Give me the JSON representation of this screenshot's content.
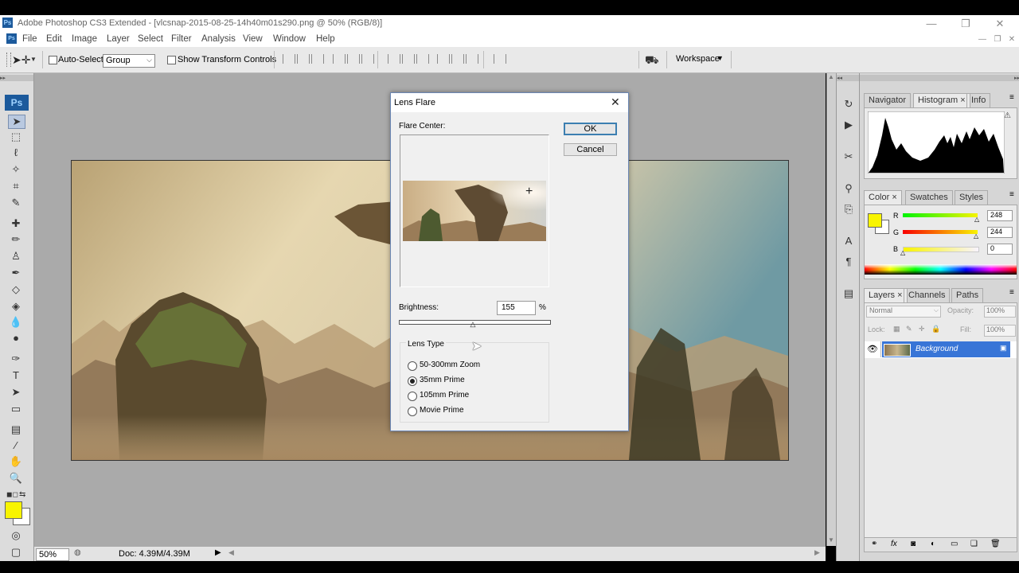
{
  "window": {
    "title": "Adobe Photoshop CS3 Extended - [vlcsnap-2015-08-25-14h40m01s290.png @ 50% (RGB/8)]",
    "app_icon": "Ps",
    "minimize": "—",
    "maximize": "❐",
    "close": "✕"
  },
  "menu": [
    "File",
    "Edit",
    "Image",
    "Layer",
    "Select",
    "Filter",
    "Analysis",
    "View",
    "Window",
    "Help"
  ],
  "options_bar": {
    "auto_select_label": "Auto-Select:",
    "auto_select_value": "Group",
    "show_transform_label": "Show Transform Controls",
    "workspace_label": "Workspace"
  },
  "toolbox": {
    "logo": "Ps",
    "foreground_color": "#f8f400",
    "background_color": "#ffffff"
  },
  "status": {
    "zoom": "50%",
    "doc": "Doc: 4.39M/4.39M"
  },
  "dialog": {
    "title": "Lens Flare",
    "flare_center_label": "Flare Center:",
    "ok": "OK",
    "cancel": "Cancel",
    "brightness_label": "Brightness:",
    "brightness_value": "155",
    "brightness_unit": "%",
    "brightness_fraction": 0.5,
    "lens_type_label": "Lens Type",
    "lens_types": [
      "50-300mm Zoom",
      "35mm Prime",
      "105mm Prime",
      "Movie Prime"
    ],
    "selected_lens": "35mm Prime"
  },
  "panels": {
    "nav_tabs": [
      "Navigator",
      "Histogram",
      "Info"
    ],
    "color_tabs": [
      "Color",
      "Swatches",
      "Styles"
    ],
    "color": {
      "r": "248",
      "g": "244",
      "b": "0",
      "r_label": "R",
      "g_label": "G",
      "b_label": "B",
      "swatch": "#f8f400"
    },
    "layers_tabs": [
      "Layers",
      "Channels",
      "Paths"
    ],
    "blend_mode": "Normal",
    "opacity_label": "Opacity:",
    "opacity_value": "100%",
    "lock_label": "Lock:",
    "fill_label": "Fill:",
    "fill_value": "100%",
    "layer_name": "Background"
  }
}
